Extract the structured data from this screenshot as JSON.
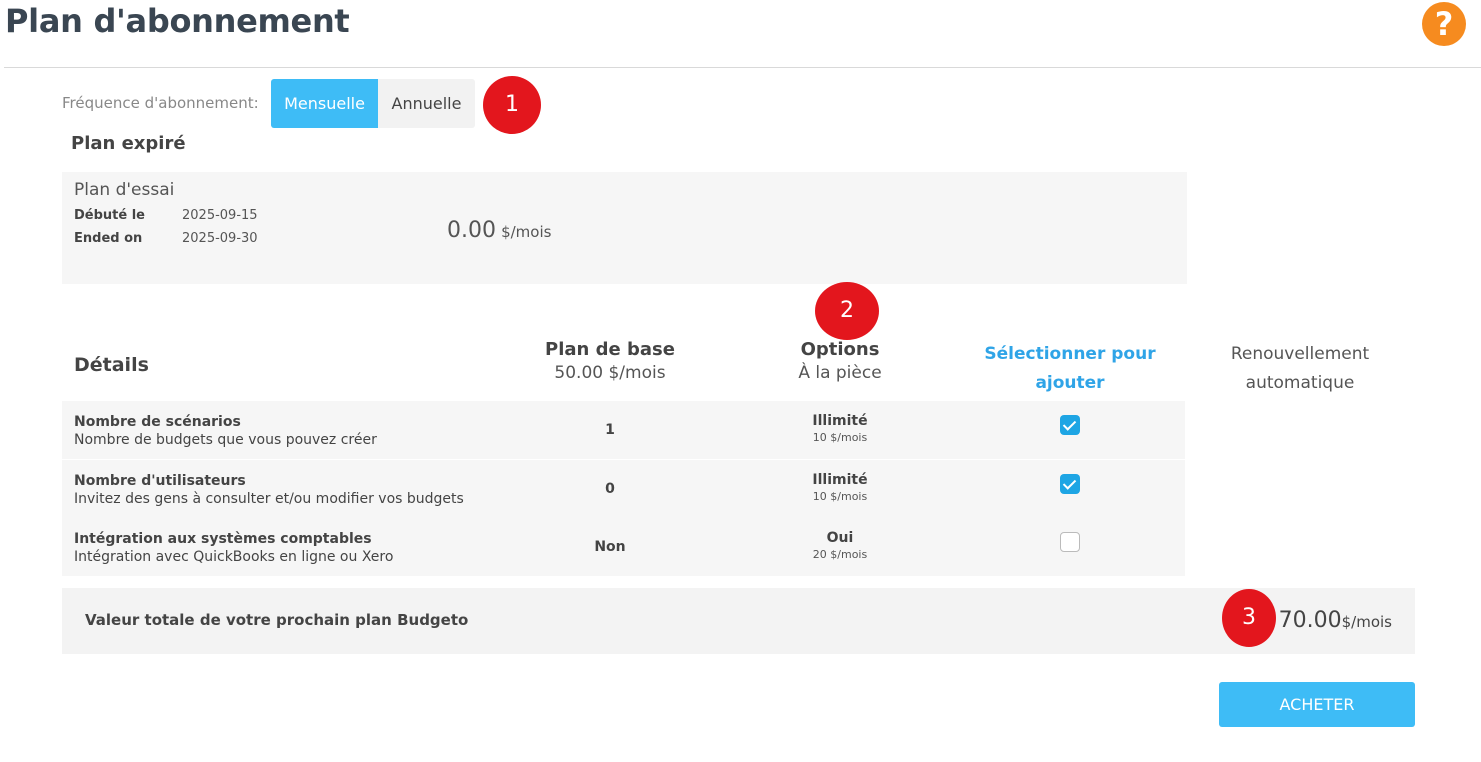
{
  "page": {
    "title": "Plan d'abonnement",
    "help_icon": "?"
  },
  "frequency": {
    "label": "Fréquence d'abonnement:",
    "options": [
      "Mensuelle",
      "Annuelle"
    ],
    "selected": "Mensuelle"
  },
  "markers": [
    "1",
    "2",
    "3"
  ],
  "expired": {
    "heading": "Plan expiré",
    "plan_name": "Plan d'essai",
    "started_label": "Débuté le",
    "started_value": "2025-09-15",
    "ended_label": "Ended on",
    "ended_value": "2025-09-30",
    "price": "0.00",
    "price_unit": "$/mois"
  },
  "details": {
    "heading": "Détails",
    "columns": {
      "base": {
        "title": "Plan de base",
        "subtitle": "50.00 $/mois"
      },
      "options": {
        "title": "Options",
        "subtitle": "À la pièce"
      },
      "select": "Sélectionner pour ajouter",
      "renew": "Renouvellement automatique"
    },
    "rows": [
      {
        "name": "Nombre de scénarios",
        "desc": "Nombre de budgets que vous pouvez créer",
        "base": "1",
        "option": "Illimité",
        "option_price": "10 $/mois",
        "checked": true
      },
      {
        "name": "Nombre d'utilisateurs",
        "desc": "Invitez des gens à consulter et/ou modifier vos budgets",
        "base": "0",
        "option": "Illimité",
        "option_price": "10 $/mois",
        "checked": true
      },
      {
        "name": "Intégration aux systèmes comptables",
        "desc": "Intégration avec QuickBooks en ligne ou Xero",
        "base": "Non",
        "option": "Oui",
        "option_price": "20 $/mois",
        "checked": false
      }
    ]
  },
  "total": {
    "label": "Valeur totale de votre prochain plan Budgeto",
    "amount": "70.00",
    "unit": "$/mois"
  },
  "buy_button": "ACHETER",
  "colors": {
    "accent": "#3ebcf6",
    "help": "#f68b1f",
    "marker": "#e3161d",
    "link": "#2fa4e7"
  }
}
